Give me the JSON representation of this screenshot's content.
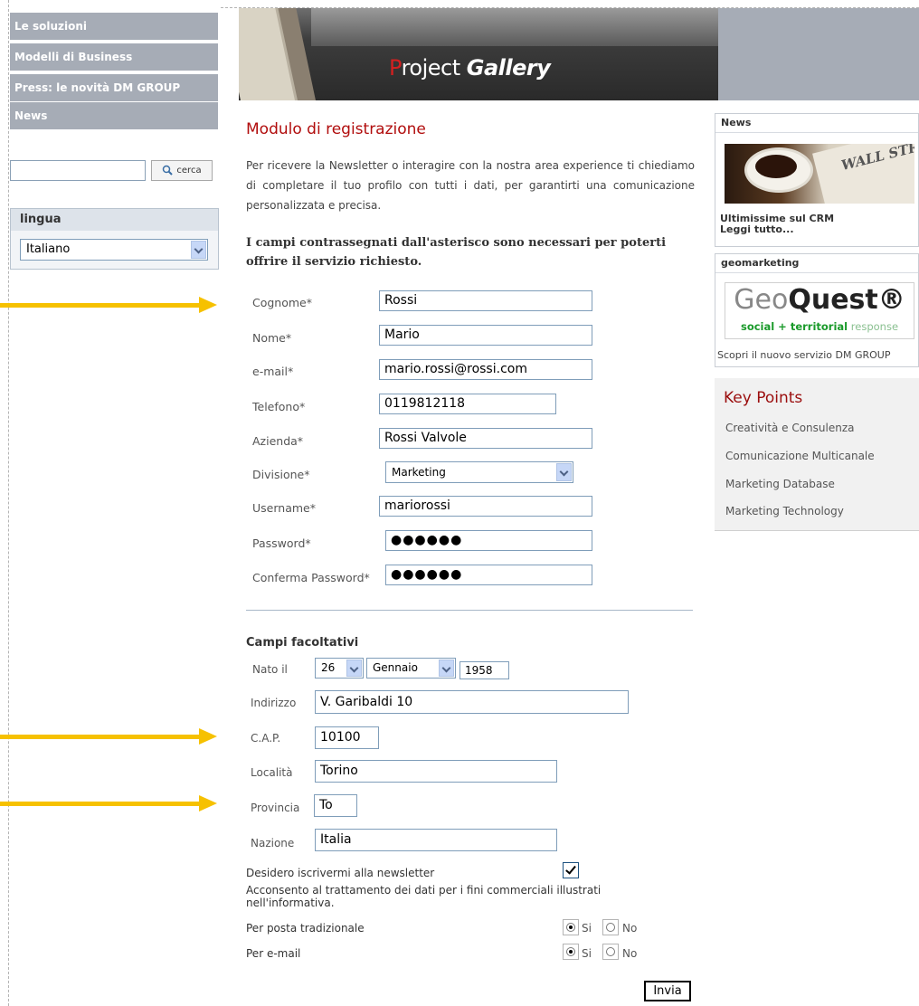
{
  "nav": {
    "items": [
      "Le soluzioni",
      "Modelli di Business",
      "Press: le novità DM GROUP",
      "News"
    ]
  },
  "search": {
    "value": "",
    "button_label": "cerca"
  },
  "lingua": {
    "title": "lingua",
    "selected": "Italiano"
  },
  "banner": {
    "title_first": "P",
    "title_rest": "roject ",
    "title_bold": "Gallery"
  },
  "form": {
    "title": "Modulo di registrazione",
    "intro": "Per ricevere la Newsletter o interagire con la nostra area experience ti chiediamo di completare il tuo profilo con tutti i dati, per garantirti una comunicazione personalizzata e precisa.",
    "notice": "I campi contrassegnati dall'asterisco sono necessari per poterti offrire il servizio richiesto.",
    "required": {
      "cognome": {
        "label": "Cognome*",
        "value": "Rossi"
      },
      "nome": {
        "label": "Nome*",
        "value": "Mario"
      },
      "email": {
        "label": "e-mail*",
        "value": "mario.rossi@rossi.com"
      },
      "telefono": {
        "label": "Telefono*",
        "value": "0119812118"
      },
      "azienda": {
        "label": "Azienda*",
        "value": "Rossi Valvole"
      },
      "divisione": {
        "label": "Divisione*",
        "value": "Marketing"
      },
      "username": {
        "label": "Username*",
        "value": "mariorossi"
      },
      "password": {
        "label": "Password*",
        "value": "●●●●●●"
      },
      "conferma": {
        "label": "Conferma Password*",
        "value": "●●●●●●"
      }
    },
    "optional_title": "Campi facoltativi",
    "optional": {
      "nato": {
        "label": "Nato il",
        "day": "26",
        "month": "Gennaio",
        "year": "1958"
      },
      "indirizzo": {
        "label": "Indirizzo",
        "value": "V. Garibaldi 10"
      },
      "cap": {
        "label": "C.A.P.",
        "value": "10100"
      },
      "localita": {
        "label": "Località",
        "value": "Torino"
      },
      "provincia": {
        "label": "Provincia",
        "value": "To"
      },
      "nazione": {
        "label": "Nazione",
        "value": "Italia"
      }
    },
    "newsletter_label": "Desidero iscrivermi alla newsletter",
    "newsletter_checked": true,
    "consent_text": "Acconsento al trattamento dei dati per i fini commerciali illustrati nell'informativa.",
    "posta": {
      "label": "Per posta tradizionale",
      "selected": "Si"
    },
    "email_consent": {
      "label": "Per e-mail",
      "selected": "Si"
    },
    "yes_label": "Si",
    "no_label": "No",
    "submit_label": "Invia"
  },
  "right": {
    "news_title": "News",
    "news_image_text": "WALL STREE",
    "news_line1": "Ultimissime sul CRM",
    "news_line2": "Leggi tutto...",
    "geo_title": "geomarketing",
    "geo_logo_light": "Geo",
    "geo_logo_bold": "Quest®",
    "geo_logo_sub_bold": "social + territorial",
    "geo_logo_sub_light": " response",
    "geo_text": "Scopri il nuovo servizio DM GROUP",
    "kp_title": "Key Points",
    "kp_items": [
      "Creatività e Consulenza",
      "Comunicazione Multicanale",
      "Marketing Database",
      "Marketing Technology"
    ]
  },
  "colors": {
    "accent_red": "#b10d0d",
    "arrow_yellow": "#f6c100",
    "nav_gray": "#a6acb6"
  }
}
